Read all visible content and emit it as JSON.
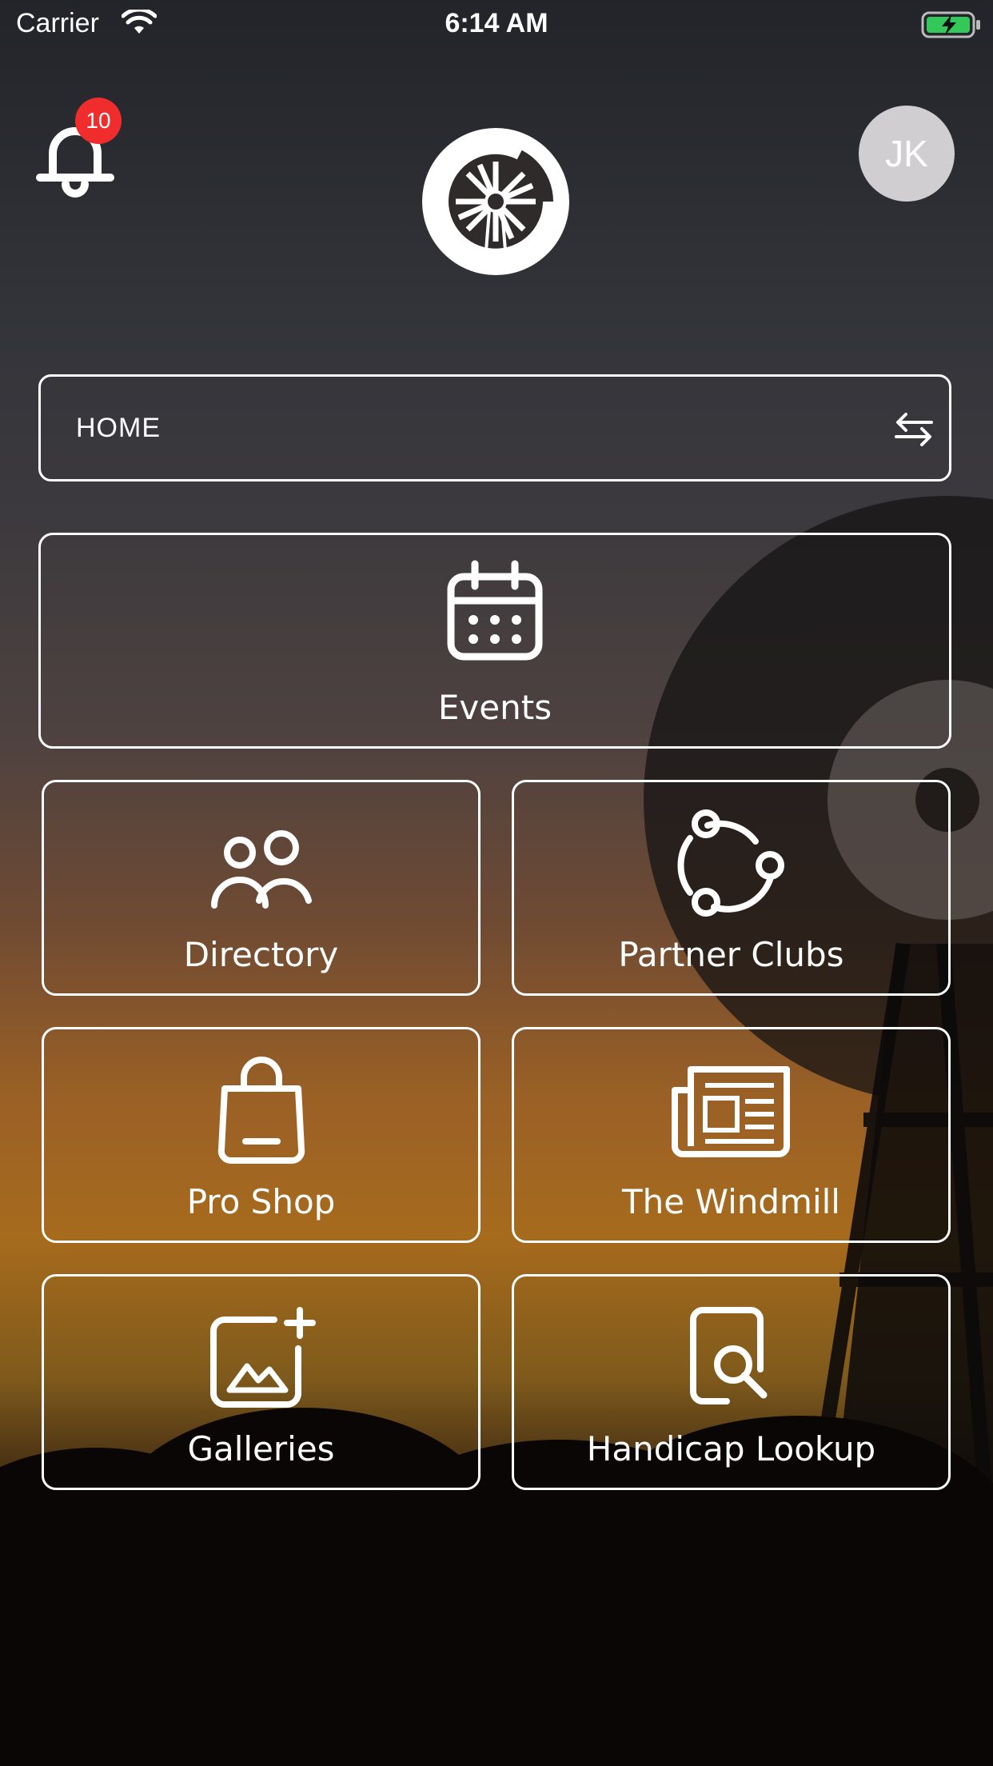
{
  "status_bar": {
    "carrier": "Carrier",
    "time": "6:14 AM"
  },
  "header": {
    "notification_count": "10",
    "avatar_initials": "JK"
  },
  "club_selector": {
    "label": "HOME"
  },
  "tiles": {
    "events": "Events",
    "directory": "Directory",
    "partner_clubs": "Partner Clubs",
    "pro_shop": "Pro Shop",
    "the_windmill": "The Windmill",
    "galleries": "Galleries",
    "handicap_lookup": "Handicap Lookup"
  },
  "colors": {
    "badge": "#f02c2c",
    "avatar_bg": "#d0ced0",
    "battery_fill": "#34c759"
  }
}
